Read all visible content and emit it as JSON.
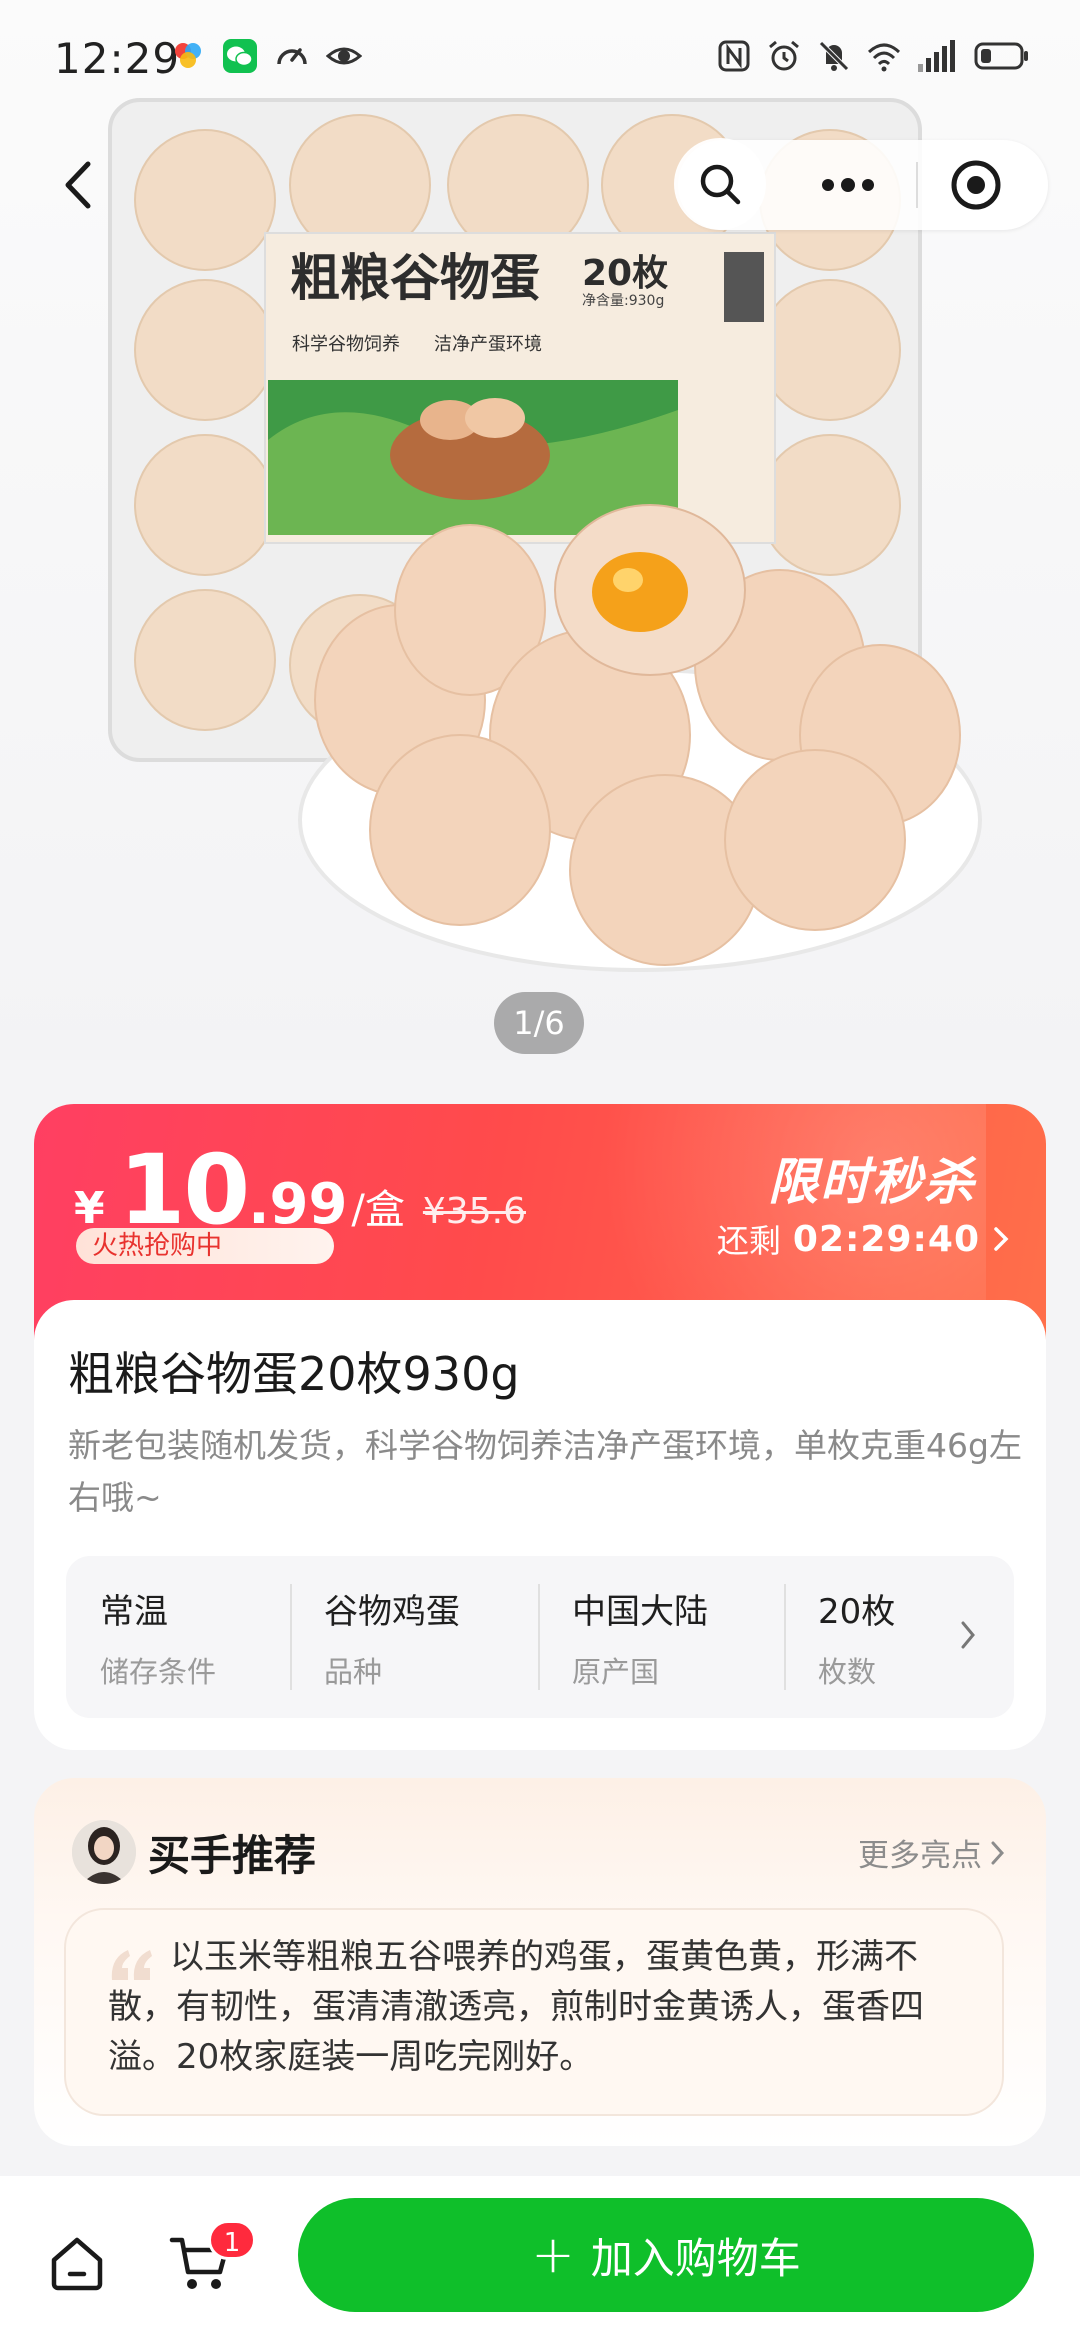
{
  "status_bar": {
    "time": "12:29",
    "left_icons": [
      "app-color-icon",
      "wechat-icon",
      "speedometer-icon",
      "eye-icon"
    ],
    "right_icons": [
      "nfc-icon",
      "alarm-icon",
      "mute-icon",
      "wifi-icon",
      "signal-icon",
      "battery-icon"
    ]
  },
  "hero": {
    "package_title": "粗粮谷物蛋",
    "package_count": "20枚",
    "package_weight": "净含量:930g",
    "package_tag1": "科学谷物饲养",
    "package_tag2": "洁净产蛋环境",
    "page_indicator": "1/6"
  },
  "flash_sale": {
    "currency": "¥",
    "price_int": "10",
    "price_dec": ".99",
    "unit": "/盒",
    "original_price": "¥35.6",
    "hot_tag": "火热抢购中",
    "title": "限时秒杀",
    "remaining_label": "还剩",
    "countdown": "02:29:40"
  },
  "product": {
    "title": "粗粮谷物蛋20枚930g",
    "description": "新老包装随机发货，科学谷物饲养洁净产蛋环境，单枚克重46g左右哦~",
    "attributes": [
      {
        "value": "常温",
        "label": "储存条件"
      },
      {
        "value": "谷物鸡蛋",
        "label": "品种"
      },
      {
        "value": "中国大陆",
        "label": "原产国"
      },
      {
        "value": "20枚",
        "label": "枚数"
      }
    ]
  },
  "recommendation": {
    "title": "买手推荐",
    "more": "更多亮点",
    "quote": "以玉米等粗粮五谷喂养的鸡蛋，蛋黄色黄，形满不散，有韧性，蛋清清澈透亮，煎制时金黄诱人，蛋香四溢。20枚家庭装一周吃完刚好。"
  },
  "bottom_bar": {
    "cart_badge": "1",
    "add_to_cart": "加入购物车"
  },
  "colors": {
    "flash_red": "#ff4b4b",
    "add_cart_green": "#0fbf2a",
    "badge_red": "#ff2a3d"
  }
}
